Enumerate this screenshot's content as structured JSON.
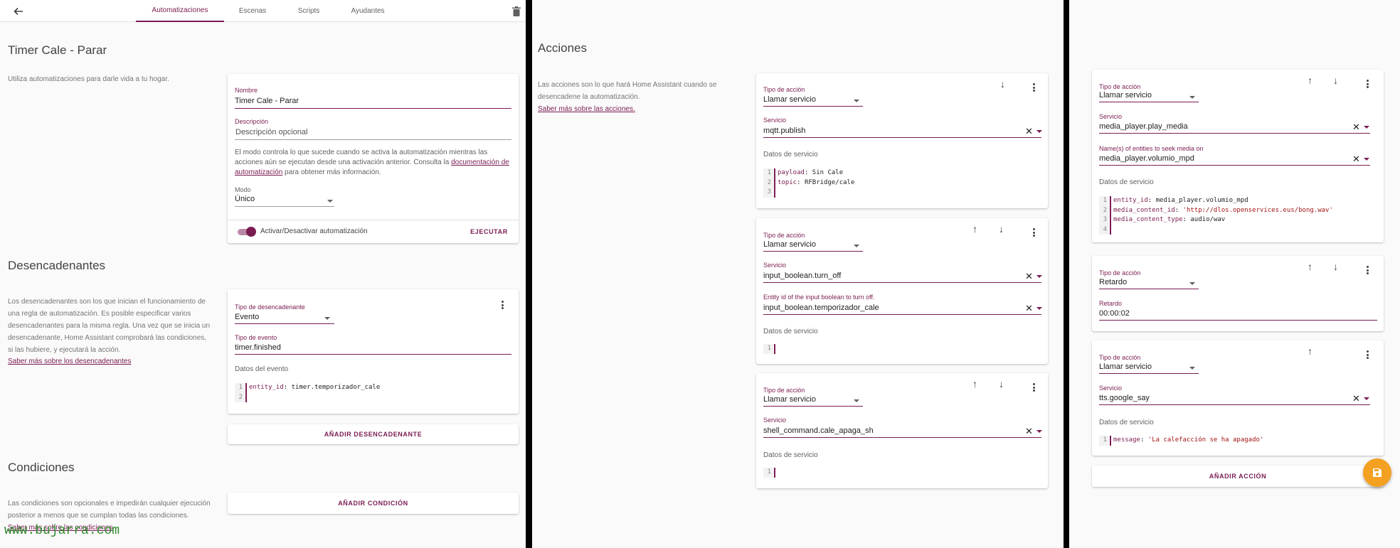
{
  "header": {
    "tabs": [
      "Automatizaciones",
      "Escenas",
      "Scripts",
      "Ayudantes"
    ]
  },
  "automation": {
    "title": "Timer Cale - Parar",
    "intro": "Utiliza automatizaciones para darle vida a tu hogar.",
    "name_label": "Nombre",
    "name_value": "Timer Cale - Parar",
    "desc_label": "Descripción",
    "desc_placeholder": "Descripción opcional",
    "mode_text_1": "El modo controla lo que sucede cuando se activa la automatización mientras las acciones aún se ejecutan desde una activación anterior. Consulta la ",
    "mode_link": "documentación de automatización",
    "mode_text_2": " para obtener más información.",
    "mode_label": "Modo",
    "mode_value": "Único",
    "toggle_label": "Activar/Desactivar automatización",
    "run_label": "EJECUTAR"
  },
  "triggers": {
    "title": "Desencadenantes",
    "description": "Los desencadenantes son los que inician el funcionamiento de una regla de automatización. Es posible especificar varios desencadenantes para la misma regla. Una vez que se inicia un desencadenante, Home Assistant comprobará las condiciones, si las hubiere, y ejecutará la acción.",
    "link": "Saber más sobre los desencadenantes",
    "type_label": "Tipo de desencadenante",
    "type_value": "Evento",
    "event_label": "Tipo de evento",
    "event_value": "timer.finished",
    "data_label": "Datos del evento",
    "code_key": "entity_id",
    "code_value": "timer.temporizador_cale",
    "add_label": "AÑADIR DESENCADENANTE"
  },
  "conditions": {
    "title": "Condiciones",
    "description": "Las condiciones son opcionales e impedirán cualquier ejecución posterior a menos que se cumplan todas las condiciones.",
    "link": "Saber más sobre las condiciones",
    "add_label": "AÑADIR CONDICIÓN"
  },
  "actions": {
    "title": "Acciones",
    "description": "Las acciones son lo que hará Home Assistant cuando se desencadene la automatización.",
    "link": "Saber más sobre las acciones.",
    "action_type_label": "Tipo de acción",
    "service_label": "Servicio",
    "service_data_label": "Datos de servicio",
    "a1": {
      "type": "Llamar servicio",
      "service": "mqtt.publish",
      "code": [
        [
          "payload",
          "Sin Cale"
        ],
        [
          "topic",
          "RFBridge/cale"
        ]
      ]
    },
    "a2": {
      "type": "Llamar servicio",
      "service": "input_boolean.turn_off",
      "entity_label": "Entity id of the input boolean to turn off.",
      "entity_value": "input_boolean.temporizador_cale"
    },
    "a3": {
      "type": "Llamar servicio",
      "service": "shell_command.cale_apaga_sh"
    },
    "a4": {
      "type": "Llamar servicio",
      "service": "media_player.play_media",
      "entity_label": "Name(s) of entities to seek media on",
      "entity_value": "media_player.volumio_mpd",
      "code": [
        [
          "entity_id",
          "media_player.volumio_mpd"
        ],
        [
          "media_content_id",
          "'http://dlos.openservices.eus/bong.wav'"
        ],
        [
          "media_content_type",
          "audio/wav"
        ]
      ]
    },
    "a5": {
      "type": "Retardo",
      "delay_label": "Retardo",
      "delay_value": "00:00:02"
    },
    "a6": {
      "type": "Llamar servicio",
      "service": "tts.google_say",
      "code": [
        [
          "message",
          "'La calefacción se ha apagado'"
        ]
      ]
    },
    "add_label": "AÑADIR ACCIÓN"
  },
  "watermark": "www.bujarra.com",
  "colors": {
    "accent": "#7a1c52",
    "fab": "#f4a020",
    "watermark": "#2e8b2e"
  }
}
